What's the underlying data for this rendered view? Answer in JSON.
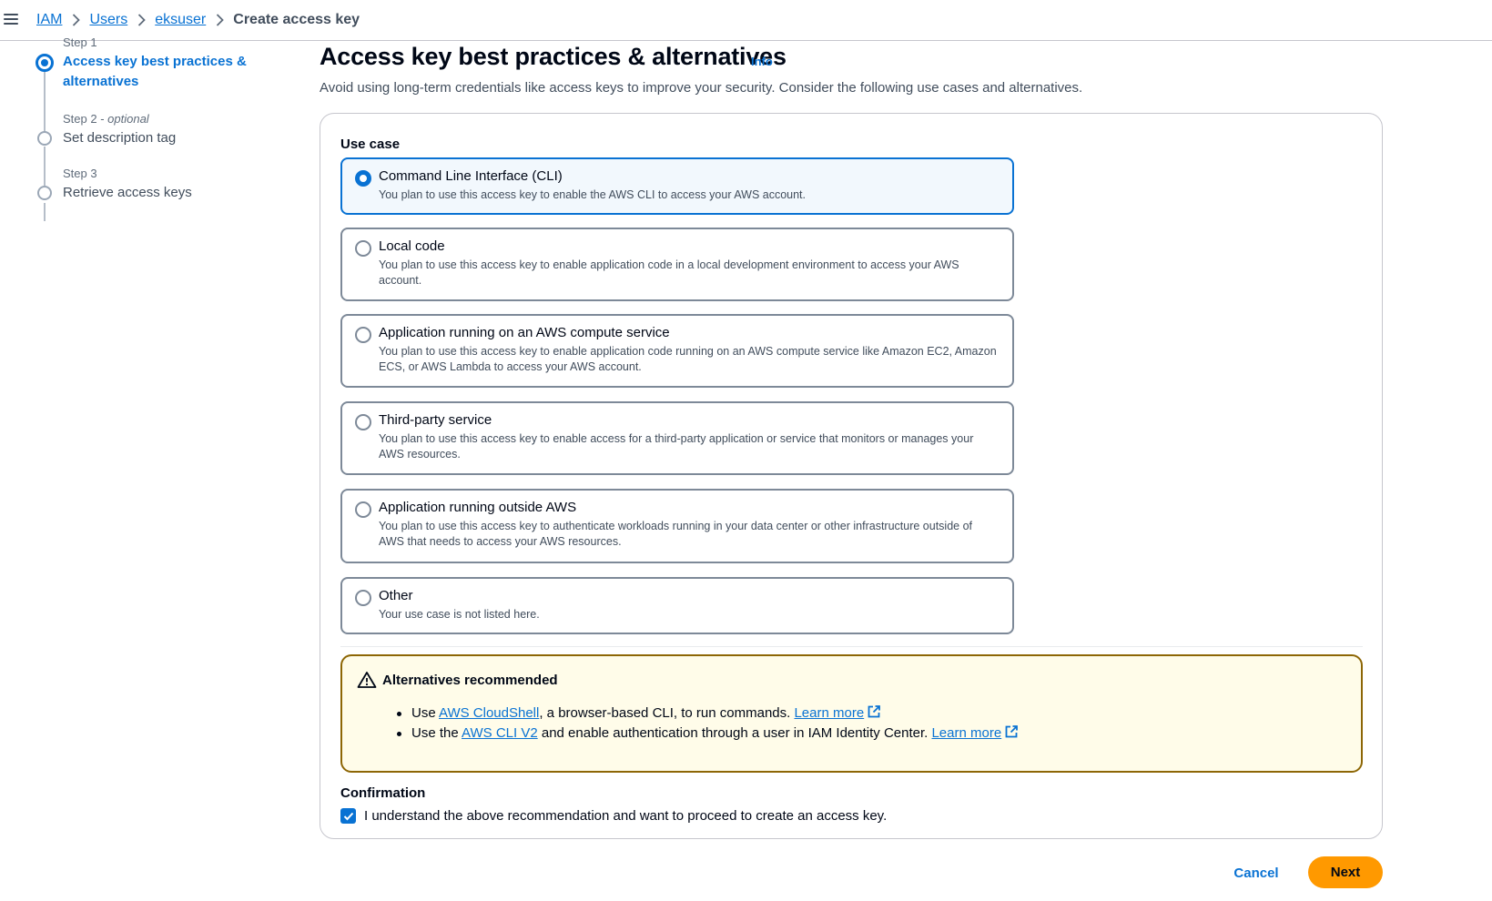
{
  "breadcrumb": {
    "items": [
      "IAM",
      "Users",
      "eksuser"
    ],
    "current": "Create access key"
  },
  "stepper": {
    "step1": {
      "label": "Step 1",
      "title": "Access key best practices & alternatives"
    },
    "step2": {
      "label": "Step 2",
      "optional": "optional",
      "title": "Set description tag"
    },
    "step3": {
      "label": "Step 3",
      "title": "Retrieve access keys"
    }
  },
  "header": {
    "title": "Access key best practices & alternatives",
    "info": "Info",
    "description": "Avoid using long-term credentials like access keys to improve your security. Consider the following use cases and alternatives."
  },
  "use_case": {
    "label": "Use case",
    "selected": "Command Line Interface (CLI)",
    "options": [
      {
        "title": "Command Line Interface (CLI)",
        "desc": "You plan to use this access key to enable the AWS CLI to access your AWS account."
      },
      {
        "title": "Local code",
        "desc": "You plan to use this access key to enable application code in a local development environment to access your AWS account."
      },
      {
        "title": "Application running on an AWS compute service",
        "desc": "You plan to use this access key to enable application code running on an AWS compute service like Amazon EC2, Amazon ECS, or AWS Lambda to access your AWS account."
      },
      {
        "title": "Third-party service",
        "desc": "You plan to use this access key to enable access for a third-party application or service that monitors or manages your AWS resources."
      },
      {
        "title": "Application running outside AWS",
        "desc": "You plan to use this access key to authenticate workloads running in your data center or other infrastructure outside of AWS that needs to access your AWS resources."
      },
      {
        "title": "Other",
        "desc": "Your use case is not listed here."
      }
    ]
  },
  "alert": {
    "title": "Alternatives recommended",
    "item1": {
      "prefix": "Use ",
      "link": "AWS CloudShell",
      "middle": ", a browser-based CLI, to run commands. ",
      "learn_more": "Learn more"
    },
    "item2": {
      "prefix": "Use the ",
      "link": "AWS CLI V2",
      "middle": " and enable authentication through a user in IAM Identity Center. ",
      "learn_more": "Learn more"
    }
  },
  "confirmation": {
    "label": "Confirmation",
    "checked": true,
    "text": "I understand the above recommendation and want to proceed to create an access key."
  },
  "footer": {
    "cancel": "Cancel",
    "next": "Next"
  },
  "colors": {
    "accent": "#0972d3",
    "primary_button": "#ff9900",
    "warning_border": "#8d6605",
    "warning_bg": "#fffce9"
  }
}
